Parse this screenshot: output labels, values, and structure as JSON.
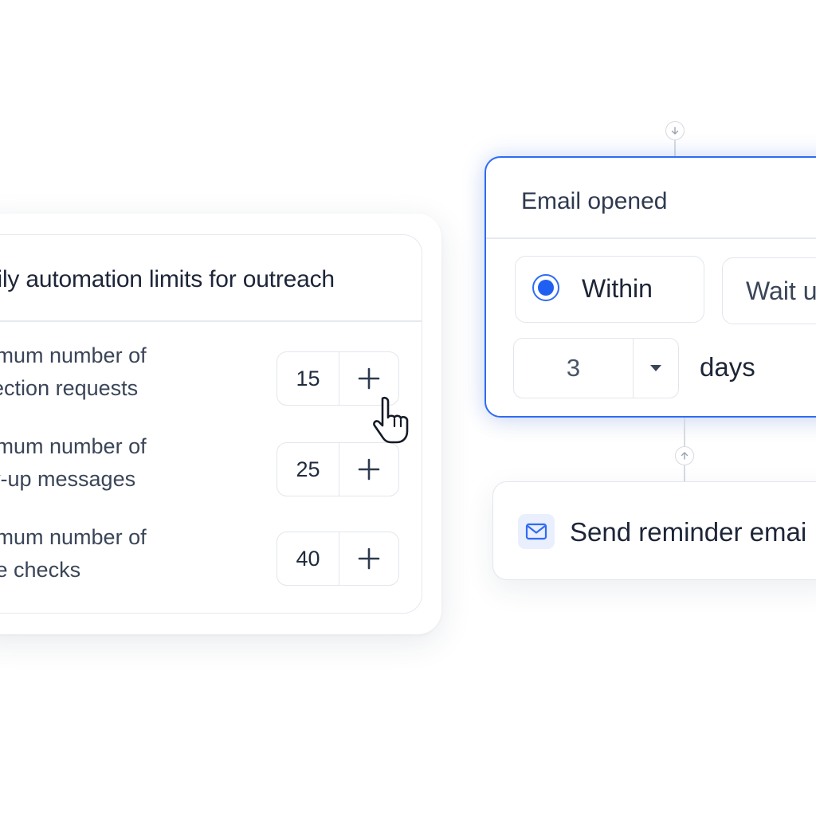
{
  "limits_panel": {
    "title": "aily automation limits for outreach",
    "items": [
      {
        "label_line1": "aximum number of",
        "label_line2": "nnection requests",
        "value": "15"
      },
      {
        "label_line1": "aximum number of",
        "label_line2": "low-up messages",
        "value": "25"
      },
      {
        "label_line1": "aximum number of",
        "label_line2": "ofile checks",
        "value": "40"
      }
    ],
    "increment_icon": "plus-icon",
    "cursor_icon": "hand-pointer-icon"
  },
  "flow": {
    "trigger": {
      "title": "Email opened",
      "options": [
        {
          "label": "Within",
          "selected": true
        },
        {
          "label": "Wait u",
          "selected": false
        }
      ],
      "duration": {
        "value": "3",
        "unit": "days"
      }
    },
    "action": {
      "icon": "mail-icon",
      "label": "Send reminder emai"
    }
  },
  "colors": {
    "accent": "#2f6bf5",
    "border": "#e2e6ec",
    "text": "#1d2538"
  }
}
